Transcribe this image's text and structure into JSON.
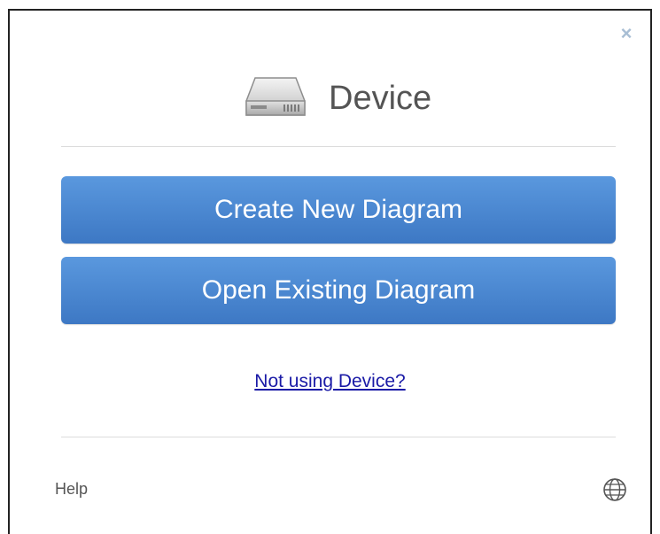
{
  "dialog": {
    "title": "Device",
    "close_symbol": "×",
    "icons": {
      "header": "hard-drive-icon",
      "close": "close-icon",
      "language": "globe-icon"
    }
  },
  "actions": {
    "create_label": "Create New Diagram",
    "open_label": "Open Existing Diagram",
    "not_using_label": "Not using Device?"
  },
  "footer": {
    "help_label": "Help"
  },
  "colors": {
    "button_top": "#5a98de",
    "button_bottom": "#3d78c4",
    "link": "#1a1aa6",
    "close": "#a8bed4",
    "title": "#545454"
  }
}
